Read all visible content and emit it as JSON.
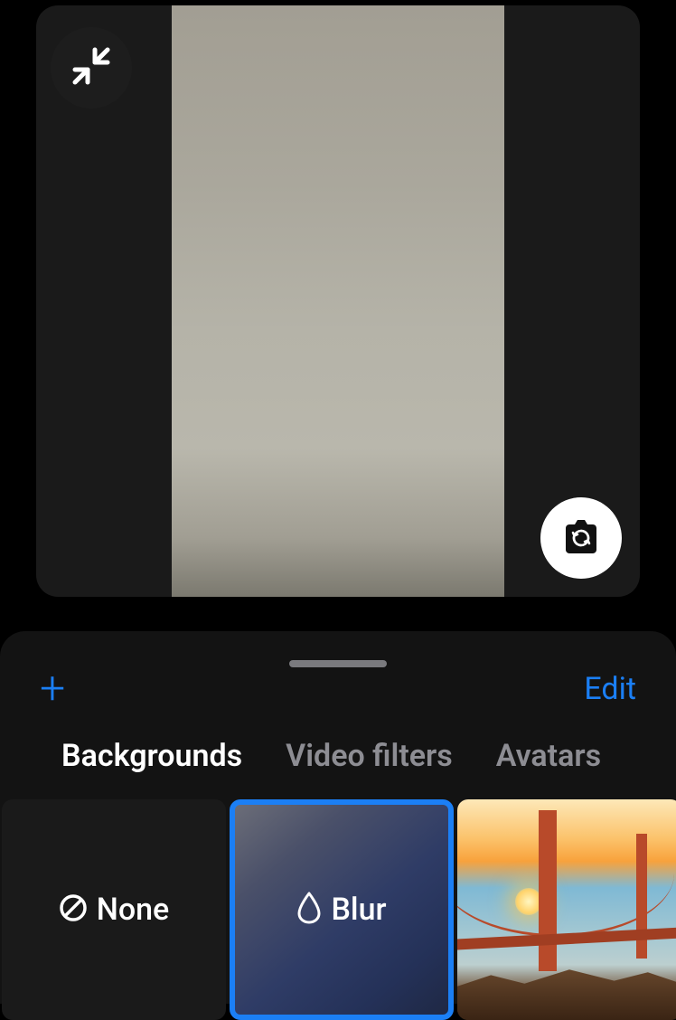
{
  "sheet": {
    "edit_label": "Edit"
  },
  "tabs": [
    {
      "label": "Backgrounds",
      "active": true
    },
    {
      "label": "Video filters",
      "active": false
    },
    {
      "label": "Avatars",
      "active": false
    }
  ],
  "options": {
    "none_label": "None",
    "blur_label": "Blur"
  }
}
